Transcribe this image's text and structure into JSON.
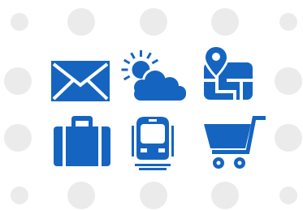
{
  "accent_color": "#1565c0",
  "dot_color": "#ebebeb",
  "icons": [
    {
      "name": "mail-envelope-icon"
    },
    {
      "name": "weather-partly-sunny-cloud-icon"
    },
    {
      "name": "map-location-pin-icon"
    },
    {
      "name": "suitcase-luggage-icon"
    },
    {
      "name": "train-metro-icon"
    },
    {
      "name": "shopping-cart-icon"
    }
  ]
}
